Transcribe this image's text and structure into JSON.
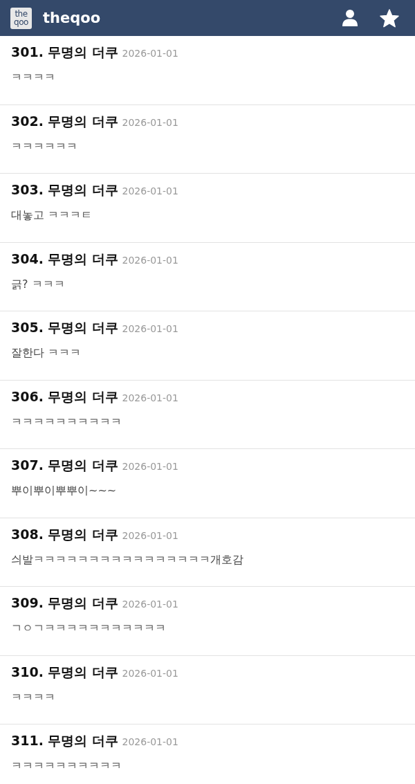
{
  "header": {
    "logo": "the qoo",
    "title": "theqoo"
  },
  "comments": [
    {
      "number": "301.",
      "author": "무명의 더쿠",
      "date": "2026-01-01",
      "text": "ㅋㅋㅋㅋ"
    },
    {
      "number": "302.",
      "author": "무명의 더쿠",
      "date": "2026-01-01",
      "text": "ㅋㅋㅋㅋㅋㅋ"
    },
    {
      "number": "303.",
      "author": "무명의 더쿠",
      "date": "2026-01-01",
      "text": "대놓고 ㅋㅋㅋㅌ"
    },
    {
      "number": "304.",
      "author": "무명의 더쿠",
      "date": "2026-01-01",
      "text": "긁? ㅋㅋㅋ"
    },
    {
      "number": "305.",
      "author": "무명의 더쿠",
      "date": "2026-01-01",
      "text": "잘한다 ㅋㅋㅋ"
    },
    {
      "number": "306.",
      "author": "무명의 더쿠",
      "date": "2026-01-01",
      "text": "ㅋㅋㅋㅋㅋㅋㅋㅋㅋㅋ"
    },
    {
      "number": "307.",
      "author": "무명의 더쿠",
      "date": "2026-01-01",
      "text": "뿌이뿌이뿌뿌이~~~"
    },
    {
      "number": "308.",
      "author": "무명의 더쿠",
      "date": "2026-01-01",
      "text": "싀발ㅋㅋㅋㅋㅋㅋㅋㅋㅋㅋㅋㅋㅋㅋㅋㅋ개호감"
    },
    {
      "number": "309.",
      "author": "무명의 더쿠",
      "date": "2026-01-01",
      "text": "ㄱㅇㄱㅋㅋㅋㅋㅋㅋㅋㅋㅋㅋㅋ"
    },
    {
      "number": "310.",
      "author": "무명의 더쿠",
      "date": "2026-01-01",
      "text": "ㅋㅋㅋㅋ"
    },
    {
      "number": "311.",
      "author": "무명의 더쿠",
      "date": "2026-01-01",
      "text": "ㅋㅋㅋㅋㅋㅋㅋㅋㅋㅋ"
    }
  ]
}
